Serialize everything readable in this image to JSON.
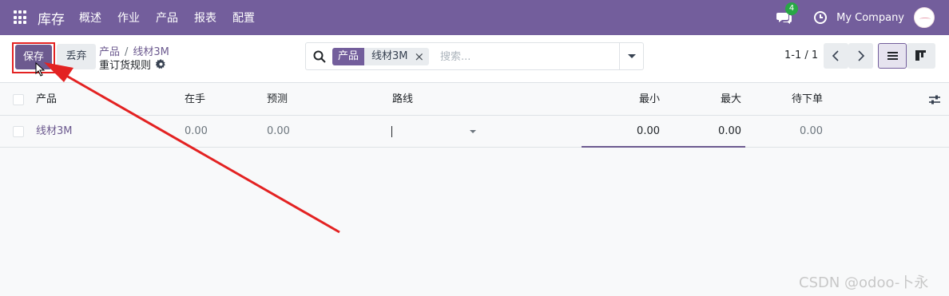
{
  "navbar": {
    "app_name": "库存",
    "menu": [
      "概述",
      "作业",
      "产品",
      "报表",
      "配置"
    ],
    "chat_badge": "4",
    "company": "My Company"
  },
  "control": {
    "save_label": "保存",
    "discard_label": "丢弃",
    "breadcrumb": [
      "产品",
      "线材3M"
    ],
    "breadcrumb_sep": "/",
    "title": "重订货规则",
    "search": {
      "facet_label": "产品",
      "facet_value": "线材3M",
      "facet_close": "×",
      "placeholder": "搜索..."
    },
    "pager": "1-1 / 1"
  },
  "table": {
    "columns": [
      "产品",
      "在手",
      "预测",
      "路线",
      "最小",
      "最大",
      "待下单"
    ],
    "rows": [
      {
        "product": "线材3M",
        "on_hand": "0.00",
        "forecast": "0.00",
        "route": "",
        "min": "0.00",
        "max": "0.00",
        "to_order": "0.00"
      }
    ]
  },
  "annotation_color": "#e32222",
  "accent_color": "#735e9c",
  "watermark": "CSDN @odoo-卜永"
}
